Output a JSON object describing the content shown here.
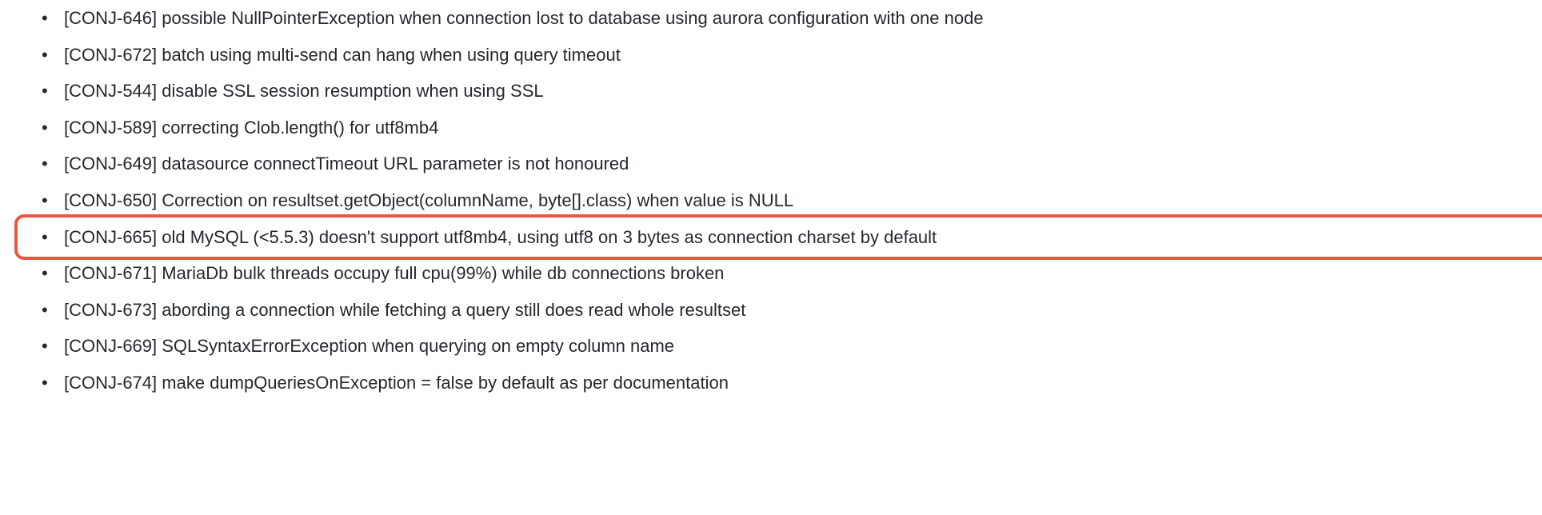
{
  "changelog": {
    "items": [
      {
        "id": "CONJ-646",
        "text": "[CONJ-646] possible NullPointerException when connection lost to database using aurora configuration with one node",
        "highlighted": false
      },
      {
        "id": "CONJ-672",
        "text": "[CONJ-672] batch using multi-send can hang when using query timeout",
        "highlighted": false
      },
      {
        "id": "CONJ-544",
        "text": "[CONJ-544] disable SSL session resumption when using SSL",
        "highlighted": false
      },
      {
        "id": "CONJ-589",
        "text": "[CONJ-589] correcting Clob.length() for utf8mb4",
        "highlighted": false
      },
      {
        "id": "CONJ-649",
        "text": "[CONJ-649] datasource connectTimeout URL parameter is not honoured",
        "highlighted": false
      },
      {
        "id": "CONJ-650",
        "text": "[CONJ-650] Correction on resultset.getObject(columnName, byte[].class) when value is NULL",
        "highlighted": false
      },
      {
        "id": "CONJ-665",
        "text": "[CONJ-665] old MySQL (<5.5.3) doesn't support utf8mb4, using utf8 on 3 bytes as connection charset by default",
        "highlighted": true
      },
      {
        "id": "CONJ-671",
        "text": "[CONJ-671] MariaDb bulk threads occupy full cpu(99%) while db connections broken",
        "highlighted": false
      },
      {
        "id": "CONJ-673",
        "text": "[CONJ-673] abording a connection while fetching a query still does read whole resultset",
        "highlighted": false
      },
      {
        "id": "CONJ-669",
        "text": "[CONJ-669] SQLSyntaxErrorException when querying on empty column name",
        "highlighted": false
      },
      {
        "id": "CONJ-674",
        "text": "[CONJ-674] make dumpQueriesOnException = false by default as per documentation",
        "highlighted": false
      }
    ]
  }
}
